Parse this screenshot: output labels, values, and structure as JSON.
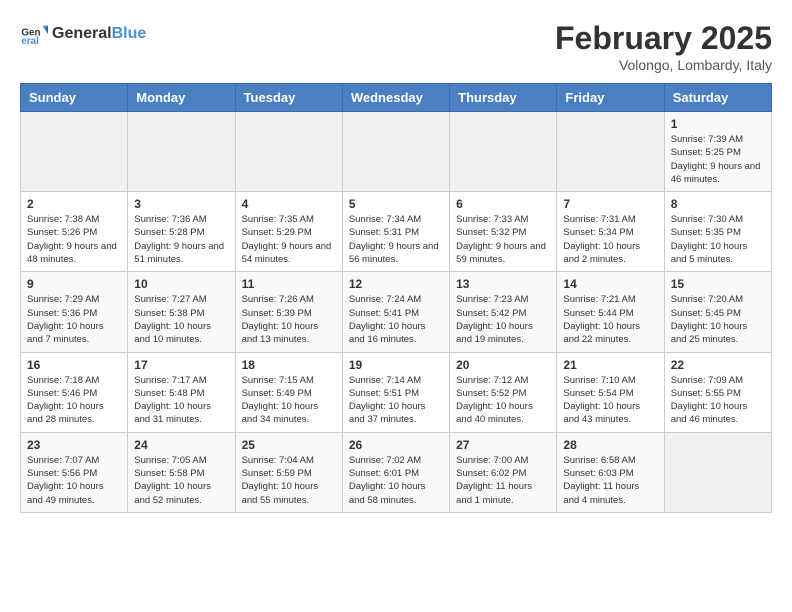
{
  "logo": {
    "general": "General",
    "blue": "Blue"
  },
  "header": {
    "title": "February 2025",
    "subtitle": "Volongo, Lombardy, Italy"
  },
  "weekdays": [
    "Sunday",
    "Monday",
    "Tuesday",
    "Wednesday",
    "Thursday",
    "Friday",
    "Saturday"
  ],
  "weeks": [
    [
      {
        "day": "",
        "info": ""
      },
      {
        "day": "",
        "info": ""
      },
      {
        "day": "",
        "info": ""
      },
      {
        "day": "",
        "info": ""
      },
      {
        "day": "",
        "info": ""
      },
      {
        "day": "",
        "info": ""
      },
      {
        "day": "1",
        "info": "Sunrise: 7:39 AM\nSunset: 5:25 PM\nDaylight: 9 hours and 46 minutes."
      }
    ],
    [
      {
        "day": "2",
        "info": "Sunrise: 7:38 AM\nSunset: 5:26 PM\nDaylight: 9 hours and 48 minutes."
      },
      {
        "day": "3",
        "info": "Sunrise: 7:36 AM\nSunset: 5:28 PM\nDaylight: 9 hours and 51 minutes."
      },
      {
        "day": "4",
        "info": "Sunrise: 7:35 AM\nSunset: 5:29 PM\nDaylight: 9 hours and 54 minutes."
      },
      {
        "day": "5",
        "info": "Sunrise: 7:34 AM\nSunset: 5:31 PM\nDaylight: 9 hours and 56 minutes."
      },
      {
        "day": "6",
        "info": "Sunrise: 7:33 AM\nSunset: 5:32 PM\nDaylight: 9 hours and 59 minutes."
      },
      {
        "day": "7",
        "info": "Sunrise: 7:31 AM\nSunset: 5:34 PM\nDaylight: 10 hours and 2 minutes."
      },
      {
        "day": "8",
        "info": "Sunrise: 7:30 AM\nSunset: 5:35 PM\nDaylight: 10 hours and 5 minutes."
      }
    ],
    [
      {
        "day": "9",
        "info": "Sunrise: 7:29 AM\nSunset: 5:36 PM\nDaylight: 10 hours and 7 minutes."
      },
      {
        "day": "10",
        "info": "Sunrise: 7:27 AM\nSunset: 5:38 PM\nDaylight: 10 hours and 10 minutes."
      },
      {
        "day": "11",
        "info": "Sunrise: 7:26 AM\nSunset: 5:39 PM\nDaylight: 10 hours and 13 minutes."
      },
      {
        "day": "12",
        "info": "Sunrise: 7:24 AM\nSunset: 5:41 PM\nDaylight: 10 hours and 16 minutes."
      },
      {
        "day": "13",
        "info": "Sunrise: 7:23 AM\nSunset: 5:42 PM\nDaylight: 10 hours and 19 minutes."
      },
      {
        "day": "14",
        "info": "Sunrise: 7:21 AM\nSunset: 5:44 PM\nDaylight: 10 hours and 22 minutes."
      },
      {
        "day": "15",
        "info": "Sunrise: 7:20 AM\nSunset: 5:45 PM\nDaylight: 10 hours and 25 minutes."
      }
    ],
    [
      {
        "day": "16",
        "info": "Sunrise: 7:18 AM\nSunset: 5:46 PM\nDaylight: 10 hours and 28 minutes."
      },
      {
        "day": "17",
        "info": "Sunrise: 7:17 AM\nSunset: 5:48 PM\nDaylight: 10 hours and 31 minutes."
      },
      {
        "day": "18",
        "info": "Sunrise: 7:15 AM\nSunset: 5:49 PM\nDaylight: 10 hours and 34 minutes."
      },
      {
        "day": "19",
        "info": "Sunrise: 7:14 AM\nSunset: 5:51 PM\nDaylight: 10 hours and 37 minutes."
      },
      {
        "day": "20",
        "info": "Sunrise: 7:12 AM\nSunset: 5:52 PM\nDaylight: 10 hours and 40 minutes."
      },
      {
        "day": "21",
        "info": "Sunrise: 7:10 AM\nSunset: 5:54 PM\nDaylight: 10 hours and 43 minutes."
      },
      {
        "day": "22",
        "info": "Sunrise: 7:09 AM\nSunset: 5:55 PM\nDaylight: 10 hours and 46 minutes."
      }
    ],
    [
      {
        "day": "23",
        "info": "Sunrise: 7:07 AM\nSunset: 5:56 PM\nDaylight: 10 hours and 49 minutes."
      },
      {
        "day": "24",
        "info": "Sunrise: 7:05 AM\nSunset: 5:58 PM\nDaylight: 10 hours and 52 minutes."
      },
      {
        "day": "25",
        "info": "Sunrise: 7:04 AM\nSunset: 5:59 PM\nDaylight: 10 hours and 55 minutes."
      },
      {
        "day": "26",
        "info": "Sunrise: 7:02 AM\nSunset: 6:01 PM\nDaylight: 10 hours and 58 minutes."
      },
      {
        "day": "27",
        "info": "Sunrise: 7:00 AM\nSunset: 6:02 PM\nDaylight: 11 hours and 1 minute."
      },
      {
        "day": "28",
        "info": "Sunrise: 6:58 AM\nSunset: 6:03 PM\nDaylight: 11 hours and 4 minutes."
      },
      {
        "day": "",
        "info": ""
      }
    ]
  ]
}
